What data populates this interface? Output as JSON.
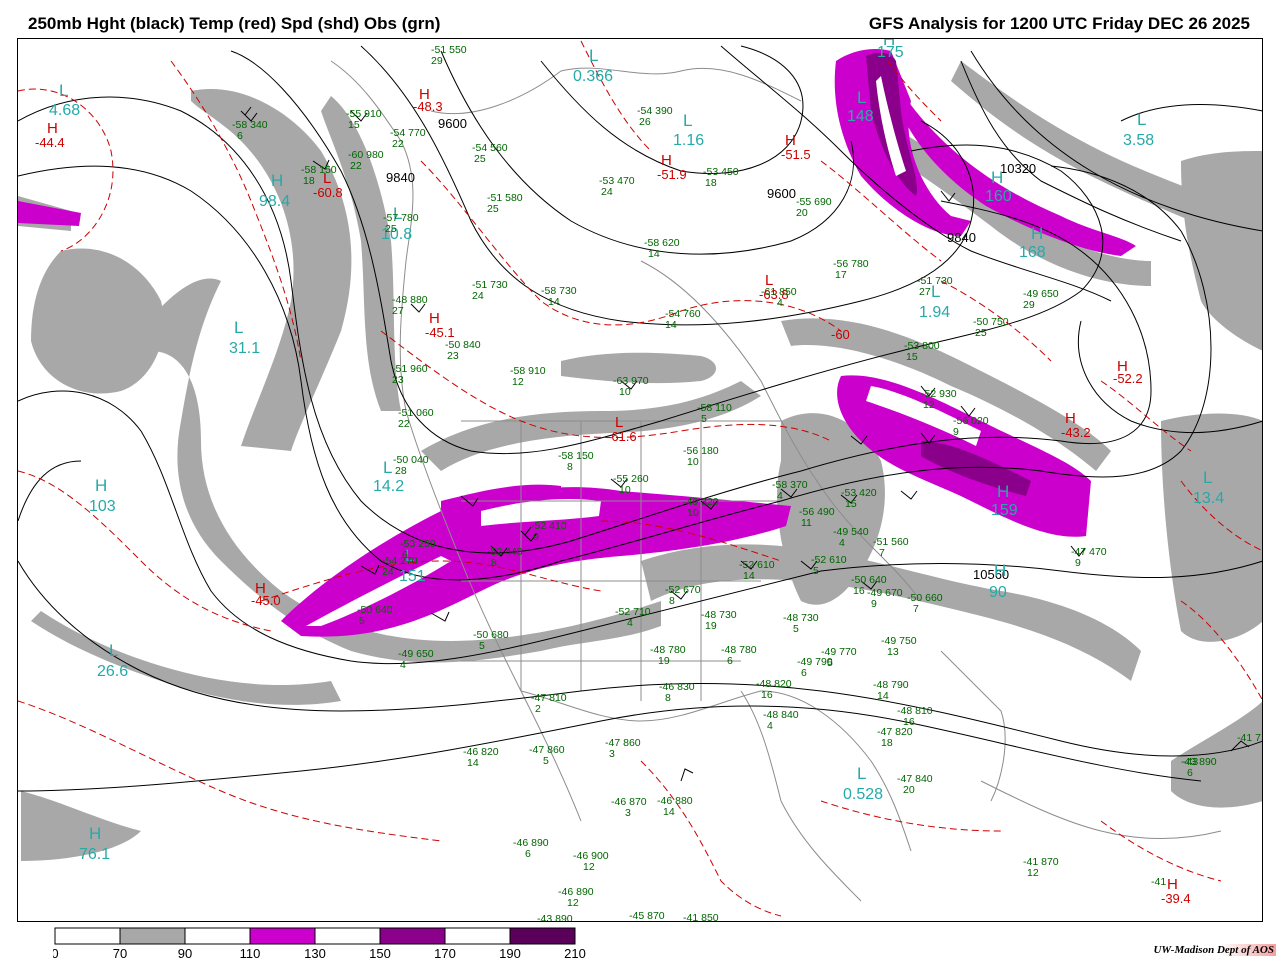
{
  "header": {
    "left_title": "250mb Hght (black) Temp (red) Spd (shd) Obs (grn)",
    "right_title": "GFS Analysis for 1200 UTC Friday  DEC 26 2025"
  },
  "credit": "UW-Madison  Dept of AOS",
  "colors": {
    "speed_70_90": "#a8a8a8",
    "speed_110_130": "#cc00cc",
    "speed_150_170": "#8a008a",
    "speed_190_210": "#5a005a",
    "height_contour": "#000000",
    "temp_contour": "#cc0000",
    "extrema_labels": "#25aaa8",
    "observations": "#006600",
    "geography": "#8c8c8c"
  },
  "color_scale": {
    "ticks": [
      "0",
      "70",
      "90",
      "110",
      "130",
      "150",
      "170",
      "190",
      "210"
    ],
    "bins": [
      {
        "color": "#ffffff"
      },
      {
        "color": "#a8a8a8"
      },
      {
        "color": "#ffffff"
      },
      {
        "color": "#cc00cc"
      },
      {
        "color": "#ffffff"
      },
      {
        "color": "#8a008a"
      },
      {
        "color": "#ffffff"
      },
      {
        "color": "#5a005a"
      }
    ]
  },
  "height_contour_labels": [
    "9600",
    "9840",
    "9600",
    "9840",
    "10320",
    "10560"
  ],
  "height_centers": [
    {
      "letter": "L",
      "value": "4.68"
    },
    {
      "letter": "L",
      "value": "0.366"
    },
    {
      "letter": "L",
      "value": "1.16"
    },
    {
      "letter": "L",
      "value": "3.58"
    },
    {
      "letter": "H",
      "value": "98.4"
    },
    {
      "letter": "L",
      "value": "10.8"
    },
    {
      "letter": "L",
      "value": "31.1"
    },
    {
      "letter": "L",
      "value": "1.94"
    },
    {
      "letter": "L",
      "value": "14.2"
    },
    {
      "letter": "H",
      "value": "103"
    },
    {
      "letter": "L",
      "value": "151"
    },
    {
      "letter": "H",
      "value": "159"
    },
    {
      "letter": "L",
      "value": "13.4"
    },
    {
      "letter": "L",
      "value": "26.6"
    },
    {
      "letter": "H",
      "value": "90"
    },
    {
      "letter": "L",
      "value": "0.528"
    },
    {
      "letter": "H",
      "value": "76.1"
    },
    {
      "letter": "H",
      "value": "168"
    },
    {
      "letter": "H",
      "value": "175"
    },
    {
      "letter": "L",
      "value": "148"
    },
    {
      "letter": "H",
      "value": "160"
    }
  ],
  "temp_centers": [
    {
      "letter": "H",
      "value": "-44.4"
    },
    {
      "letter": "H",
      "value": "-48.3"
    },
    {
      "letter": "L",
      "value": "-60.8"
    },
    {
      "letter": "H",
      "value": "-51.9"
    },
    {
      "letter": "H",
      "value": "-51.5"
    },
    {
      "letter": "H",
      "value": "-45.1"
    },
    {
      "letter": "L",
      "value": "-61.6"
    },
    {
      "letter": "L",
      "value": "-63.8"
    },
    {
      "letter": "H",
      "value": "-45.0"
    },
    {
      "letter": "H",
      "value": "-52.2"
    },
    {
      "letter": "H",
      "value": "-43.2"
    },
    {
      "letter": "H",
      "value": "-39.4"
    }
  ],
  "temp_contour_labels": [
    "-60"
  ],
  "observations": [
    {
      "t": "-51",
      "h": "550",
      "d": "29"
    },
    {
      "t": "-58",
      "h": "340",
      "d": "6"
    },
    {
      "t": "-55",
      "h": "910",
      "d": "15"
    },
    {
      "t": "-54",
      "h": "770",
      "d": "22"
    },
    {
      "t": "-60",
      "h": "980",
      "d": "22"
    },
    {
      "t": "-58",
      "h": "150",
      "d": "18"
    },
    {
      "t": "-54",
      "h": "560",
      "d": "25"
    },
    {
      "t": "-53",
      "h": "470",
      "d": "24"
    },
    {
      "t": "-54",
      "h": "390",
      "d": "26"
    },
    {
      "t": "-53",
      "h": "450",
      "d": "18"
    },
    {
      "t": "-51",
      "h": "580",
      "d": "25"
    },
    {
      "t": "-55",
      "h": "690",
      "d": "20"
    },
    {
      "t": "-58",
      "h": "620",
      "d": "14"
    },
    {
      "t": "-56",
      "h": "780",
      "d": "17"
    },
    {
      "t": "-61",
      "h": "850",
      "d": "4"
    },
    {
      "t": "-51",
      "h": "730",
      "d": "27"
    },
    {
      "t": "-49",
      "h": "650",
      "d": "29"
    },
    {
      "t": "-57",
      "h": "780",
      "d": "25"
    },
    {
      "t": "-51",
      "h": "730",
      "d": "24"
    },
    {
      "t": "-58",
      "h": "730",
      "d": "14"
    },
    {
      "t": "-54",
      "h": "760",
      "d": "14"
    },
    {
      "t": "-50",
      "h": "750",
      "d": "25"
    },
    {
      "t": "-48",
      "h": "880",
      "d": "27"
    },
    {
      "t": "-50",
      "h": "840",
      "d": "23"
    },
    {
      "t": "-53",
      "h": "800",
      "d": "15"
    },
    {
      "t": "-58",
      "h": "910",
      "d": "12"
    },
    {
      "t": "-63",
      "h": "970",
      "d": "10"
    },
    {
      "t": "-52",
      "h": "930",
      "d": "12"
    },
    {
      "t": "-51",
      "h": "960",
      "d": "23"
    },
    {
      "t": "-51",
      "h": "060",
      "d": "22"
    },
    {
      "t": "-58",
      "h": "110",
      "d": "5"
    },
    {
      "t": "-56",
      "h": "180",
      "d": "10"
    },
    {
      "t": "-56",
      "h": "020",
      "d": "9"
    },
    {
      "t": "-50",
      "h": "040",
      "d": "28"
    },
    {
      "t": "-58",
      "h": "150",
      "d": "8"
    },
    {
      "t": "-55",
      "h": "260",
      "d": "10"
    },
    {
      "t": "-49",
      "h": "320",
      "d": "10"
    },
    {
      "t": "-58",
      "h": "370",
      "d": "4"
    },
    {
      "t": "-53",
      "h": "420",
      "d": "15"
    },
    {
      "t": "-56",
      "h": "490",
      "d": "11"
    },
    {
      "t": "-52",
      "h": "410",
      "d": "9"
    },
    {
      "t": "-53",
      "h": "250",
      "d": "6"
    },
    {
      "t": "-54",
      "h": "270",
      "d": "24"
    },
    {
      "t": "-52",
      "h": "440",
      "d": "8"
    },
    {
      "t": "-49",
      "h": "540",
      "d": "4"
    },
    {
      "t": "-51",
      "h": "560",
      "d": "7"
    },
    {
      "t": "-52",
      "h": "610",
      "d": "14"
    },
    {
      "t": "-52",
      "h": "610",
      "d": "5"
    },
    {
      "t": "-50",
      "h": "640",
      "d": "16"
    },
    {
      "t": "-49",
      "h": "670",
      "d": "9"
    },
    {
      "t": "-50",
      "h": "660",
      "d": "7"
    },
    {
      "t": "-47",
      "h": "470",
      "d": "9"
    },
    {
      "t": "-50",
      "h": "640",
      "d": "5"
    },
    {
      "t": "-52",
      "h": "670",
      "d": "8"
    },
    {
      "t": "-52",
      "h": "710",
      "d": "4"
    },
    {
      "t": "-48",
      "h": "730",
      "d": "19"
    },
    {
      "t": "-48",
      "h": "730",
      "d": "5"
    },
    {
      "t": "-50",
      "h": "680",
      "d": "5"
    },
    {
      "t": "-49",
      "h": "650",
      "d": "4"
    },
    {
      "t": "-48",
      "h": "780",
      "d": "19"
    },
    {
      "t": "-48",
      "h": "780",
      "d": "6"
    },
    {
      "t": "-49",
      "h": "790",
      "d": "6"
    },
    {
      "t": "-49",
      "h": "770",
      "d": "5"
    },
    {
      "t": "-49",
      "h": "750",
      "d": "13"
    },
    {
      "t": "-46",
      "h": "830",
      "d": "8"
    },
    {
      "t": "-47",
      "h": "810",
      "d": "2"
    },
    {
      "t": "-48",
      "h": "820",
      "d": "16"
    },
    {
      "t": "-48",
      "h": "790",
      "d": "14"
    },
    {
      "t": "-48",
      "h": "840",
      "d": "4"
    },
    {
      "t": "-48",
      "h": "810",
      "d": "16"
    },
    {
      "t": "-47",
      "h": "820",
      "d": "18"
    },
    {
      "t": "-46",
      "h": "820",
      "d": "14"
    },
    {
      "t": "-47",
      "h": "860",
      "d": "5"
    },
    {
      "t": "-47",
      "h": "860",
      "d": "3"
    },
    {
      "t": "-46",
      "h": "870",
      "d": "3"
    },
    {
      "t": "-46",
      "h": "880",
      "d": "14"
    },
    {
      "t": "-47",
      "h": "840",
      "d": "20"
    },
    {
      "t": "-43",
      "h": "890",
      "d": "6"
    },
    {
      "t": "-46",
      "h": "890",
      "d": "6"
    },
    {
      "t": "-46",
      "h": "900",
      "d": "12"
    },
    {
      "t": "-46",
      "h": "890",
      "d": "12"
    },
    {
      "t": "-41",
      "h": "870",
      "d": "12"
    },
    {
      "t": "-43",
      "h": "890",
      "d": ""
    },
    {
      "t": "-45",
      "h": "870",
      "d": ""
    },
    {
      "t": "-41",
      "h": "850",
      "d": ""
    },
    {
      "t": "-41",
      "h": "7",
      "d": ""
    },
    {
      "t": "-43",
      "h": "900",
      "d": ""
    },
    {
      "t": "-41",
      "h": "",
      "d": ""
    }
  ]
}
